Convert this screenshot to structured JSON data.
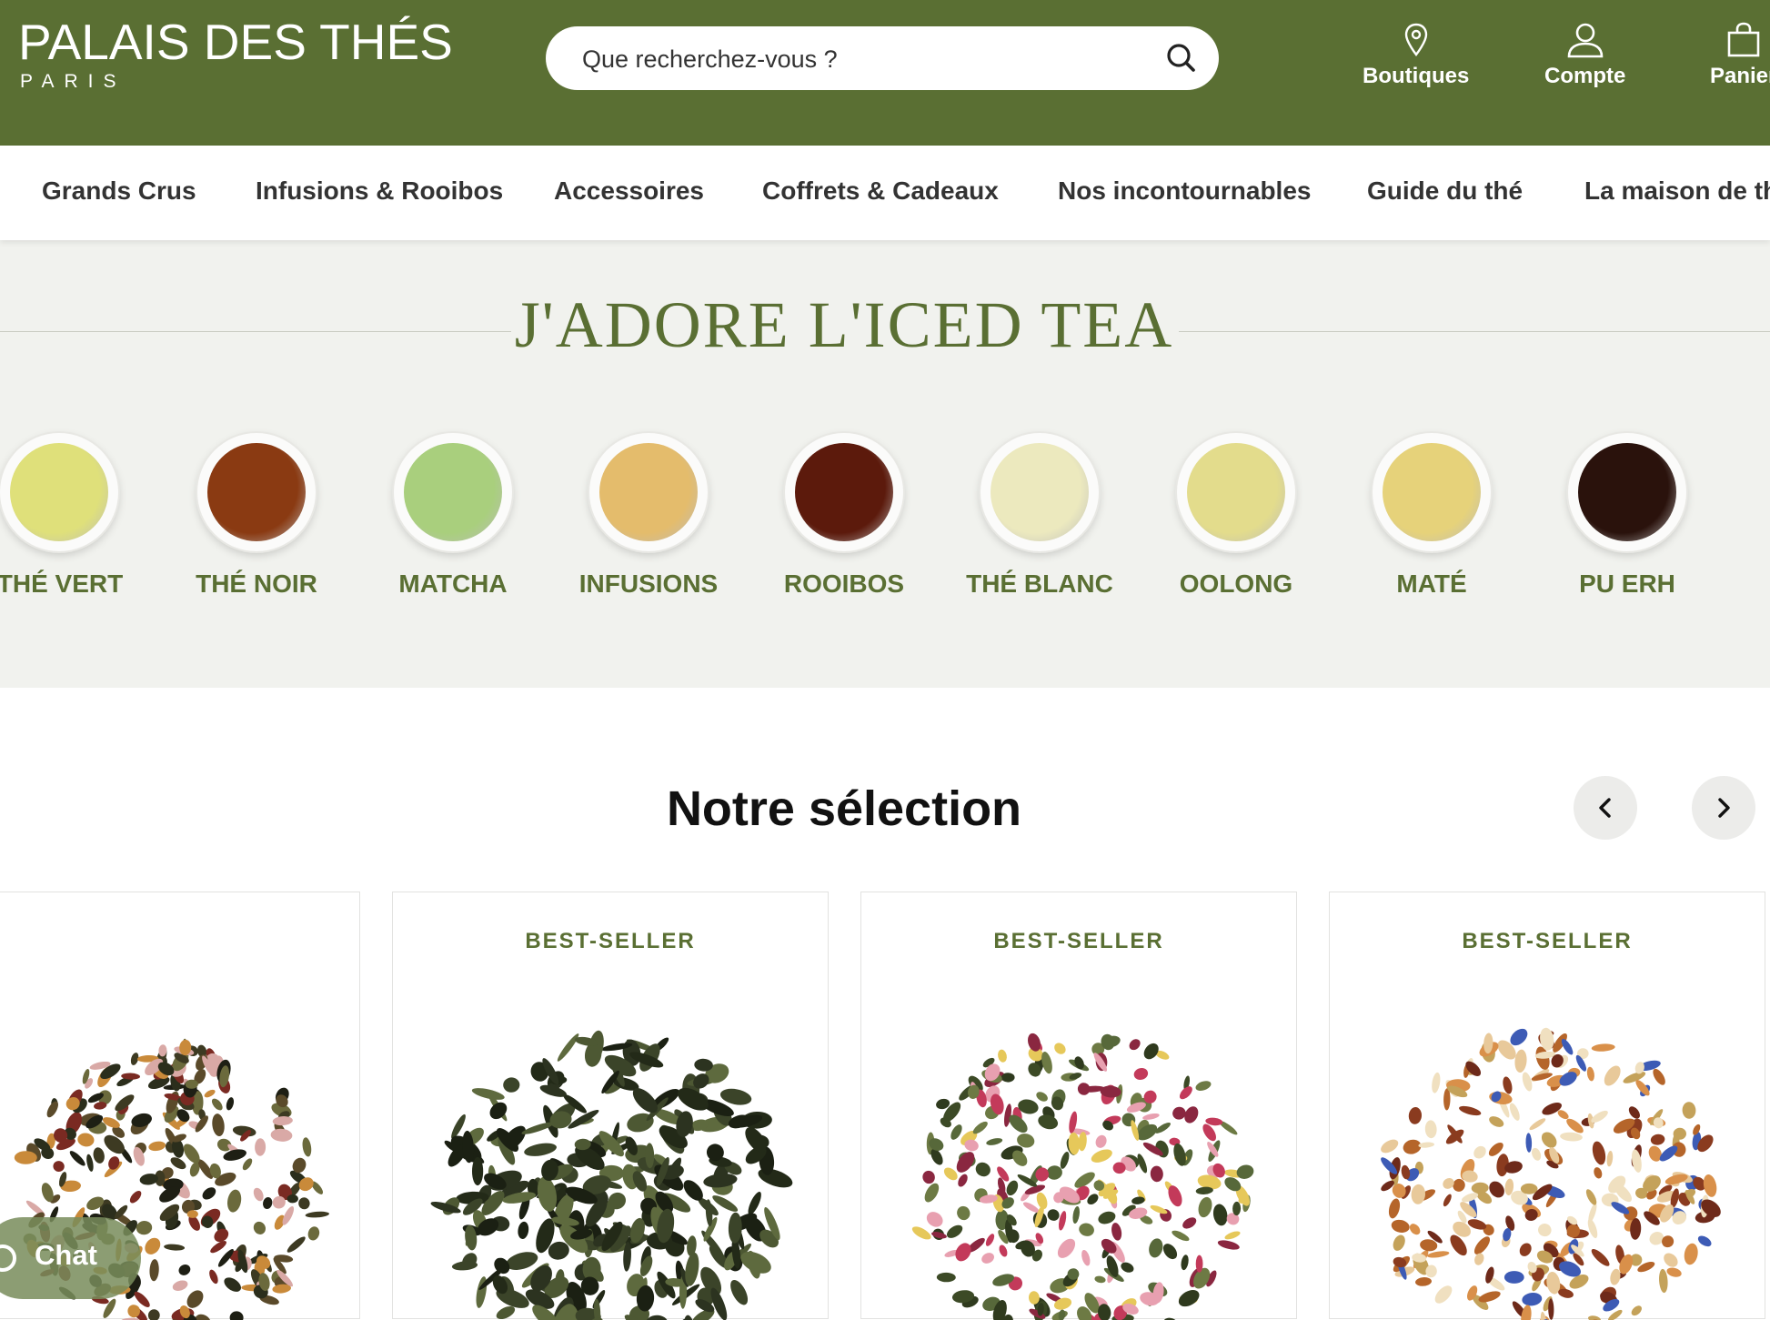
{
  "brand": {
    "name": "PALAIS DES THÉS",
    "city": "PARIS"
  },
  "search": {
    "placeholder": "Que recherchez-vous ?"
  },
  "header_links": [
    {
      "label": "Boutiques",
      "icon": "map-pin-icon"
    },
    {
      "label": "Compte",
      "icon": "user-icon"
    },
    {
      "label": "Panier",
      "icon": "shopping-bag-icon"
    }
  ],
  "nav": [
    "Grands Crus",
    "Infusions & Rooibos",
    "Accessoires",
    "Coffrets & Cadeaux",
    "Nos incontournables",
    "Guide du thé",
    "La maison de thé"
  ],
  "iced_tea": {
    "title": "J'ADORE L'ICED TEA",
    "categories": [
      {
        "label": "THÉ VERT",
        "color": "#dfe07a"
      },
      {
        "label": "THÉ NOIR",
        "color": "#8a3a12"
      },
      {
        "label": "MATCHA",
        "color": "#a9cf7d"
      },
      {
        "label": "INFUSIONS",
        "color": "#e4bc6c"
      },
      {
        "label": "ROOIBOS",
        "color": "#5c1a0c"
      },
      {
        "label": "THÉ BLANC",
        "color": "#ece9be"
      },
      {
        "label": "OOLONG",
        "color": "#e3dc8c"
      },
      {
        "label": "MATÉ",
        "color": "#e6d27a"
      },
      {
        "label": "PU ERH",
        "color": "#2a120c"
      }
    ]
  },
  "selection": {
    "title": "Notre sélection",
    "prev_icon": "chevron-left-icon",
    "next_icon": "chevron-right-icon",
    "products": [
      {
        "badge": "",
        "tea": "mixed-dark"
      },
      {
        "badge": "BEST-SELLER",
        "tea": "oolong-rolled"
      },
      {
        "badge": "BEST-SELLER",
        "tea": "green-petals"
      },
      {
        "badge": "BEST-SELLER",
        "tea": "fruit-infusion"
      }
    ]
  },
  "chat": {
    "label": "Chat"
  },
  "colors": {
    "brand_green": "#5a6f33",
    "section_bg": "#f1f2ee"
  }
}
